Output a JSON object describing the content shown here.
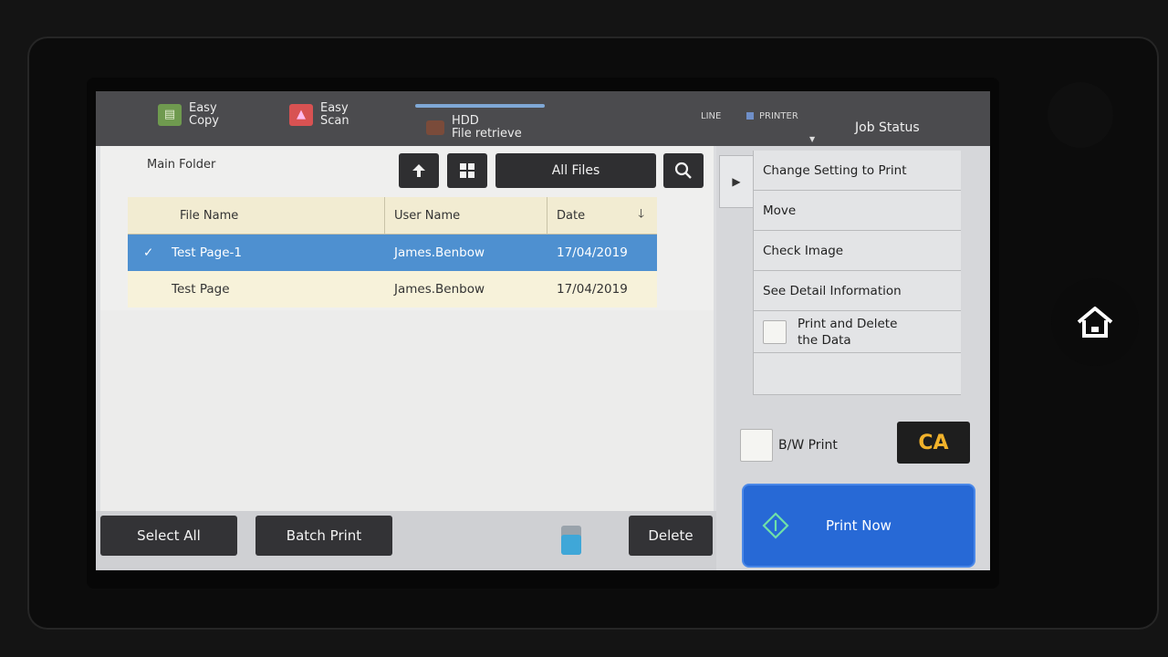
{
  "topbar": {
    "easy_copy": "Easy\nCopy",
    "easy_copy_l1": "Easy",
    "easy_copy_l2": "Copy",
    "easy_scan_l1": "Easy",
    "easy_scan_l2": "Scan",
    "hdd_l1": "HDD",
    "hdd_l2": "File retrieve",
    "line": "LINE",
    "printer": "PRINTER",
    "job_status": "Job Status"
  },
  "toolbar": {
    "folder": "Main Folder",
    "filter": "All Files"
  },
  "table": {
    "headers": {
      "file_name": "File Name",
      "user_name": "User Name",
      "date": "Date"
    },
    "rows": [
      {
        "file": "Test Page-1",
        "user": "James.Benbow",
        "date": "17/04/2019",
        "selected": true
      },
      {
        "file": "Test Page",
        "user": "James.Benbow",
        "date": "17/04/2019",
        "selected": false
      }
    ]
  },
  "bottom": {
    "select_all": "Select All",
    "batch_print": "Batch Print",
    "delete": "Delete"
  },
  "menu": {
    "change_setting": "Change Setting to Print",
    "move": "Move",
    "check_image": "Check Image",
    "detail": "See Detail Information",
    "print_delete_l1": "Print and Delete",
    "print_delete_l2": "the Data"
  },
  "actions": {
    "bw_print": "B/W Print",
    "ca": "CA",
    "print_now": "Print Now"
  },
  "colors": {
    "selected_row": "#4e90d0",
    "print_now": "#2769d6",
    "ca_text": "#f1b22b"
  }
}
